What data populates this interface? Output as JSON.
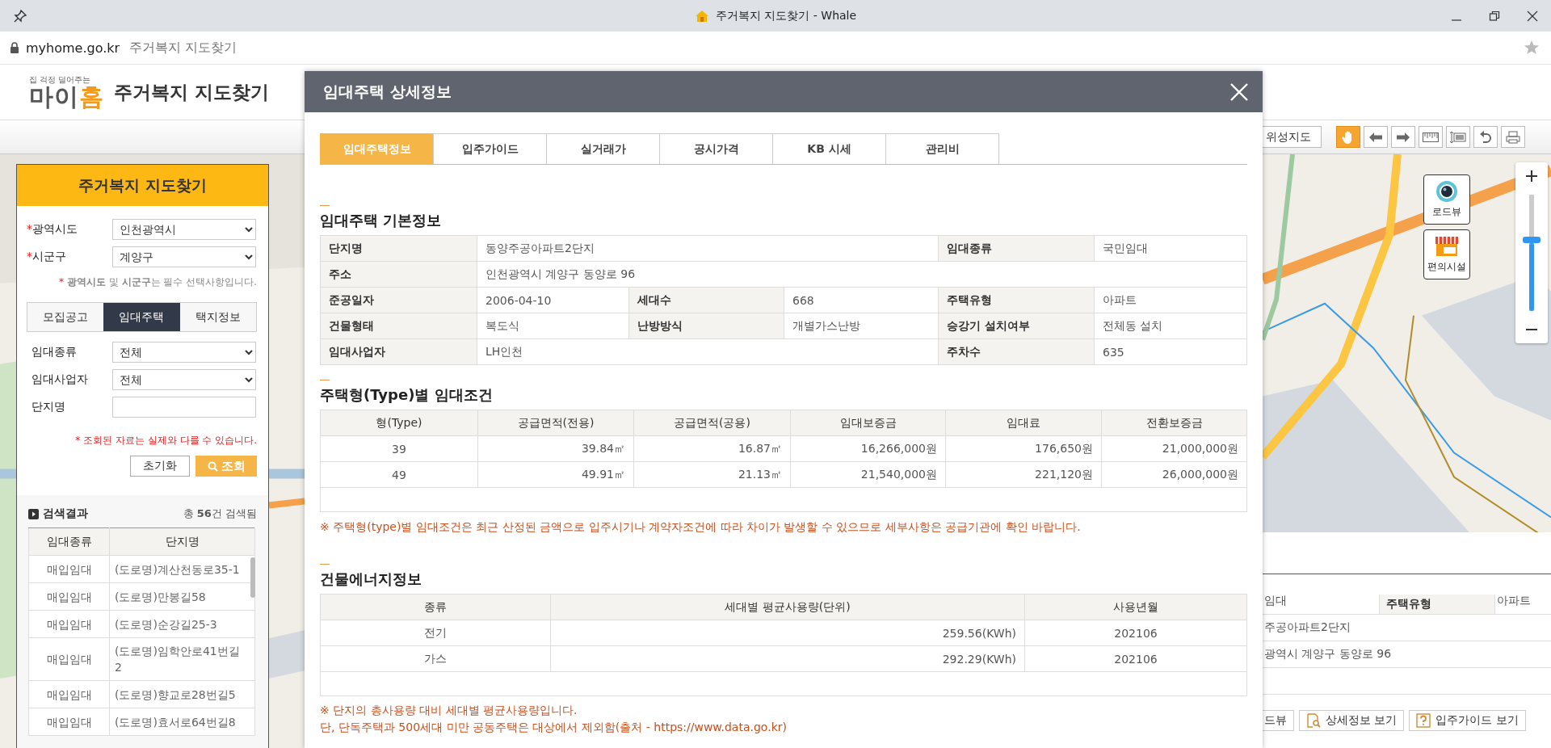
{
  "browser": {
    "title": "주거복지 지도찾기 - Whale",
    "url": "myhome.go.kr",
    "page_title": "주거복지 지도찾기"
  },
  "site_header": {
    "logo_tagline": "집 걱정 덜어주는",
    "logo_main": "마이",
    "logo_accent": "홈",
    "title": "주거복지 지도찾기"
  },
  "map_toolbar": {
    "satellite_button": "위성지도",
    "tools": [
      {
        "kind": "hand",
        "selected": true
      },
      {
        "kind": "prev",
        "selected": false
      },
      {
        "kind": "next",
        "selected": false
      },
      {
        "kind": "ruler",
        "selected": false
      },
      {
        "kind": "area",
        "selected": false
      },
      {
        "kind": "undo",
        "selected": false
      },
      {
        "kind": "print",
        "selected": false
      }
    ]
  },
  "map_overlay": {
    "buttons": [
      {
        "kind": "roadview",
        "label": "로드뷰"
      },
      {
        "kind": "facility",
        "label": "편의시설"
      }
    ],
    "zoom_slider": {
      "level": 0.62
    }
  },
  "search_panel": {
    "title": "주거복지 지도찾기",
    "fields": [
      {
        "mark": "*",
        "label": "광역시도",
        "kind": "select",
        "value": "인천광역시"
      },
      {
        "mark": "*",
        "label": "시군구",
        "kind": "select",
        "value": "계양구"
      }
    ],
    "note_mark": "*",
    "note": "**광역시도** 및 **시군구**는 필수 선택사항입니다.",
    "tabs": [
      {
        "label": "모집공고",
        "selected": false
      },
      {
        "label": "임대주택",
        "selected": true
      },
      {
        "label": "택지정보",
        "selected": false
      }
    ],
    "filters": [
      {
        "label": "임대종류",
        "kind": "select",
        "value": "전체"
      },
      {
        "label": "임대사업자",
        "kind": "select",
        "value": "전체"
      },
      {
        "label": "단지명",
        "kind": "input"
      }
    ],
    "disclaimer": "* 조회된 자료는 실제와 다를 수 있습니다.",
    "reset_button": "초기화",
    "search_button": "조회",
    "results": {
      "title": "검색결과",
      "total": "총 **56**건 검색됨",
      "columns": [
        "임대종류",
        "단지명"
      ],
      "rows": [
        [
          "매입임대",
          "(도로명)계산천동로35-1"
        ],
        [
          "매입임대",
          "(도로명)만봉길58"
        ],
        [
          "매입임대",
          "(도로명)순강길25-3"
        ],
        [
          "매입임대",
          "(도로명)임학안로41번길2"
        ],
        [
          "매입임대",
          "(도로명)향교로28번길5"
        ],
        [
          "매입임대",
          "(도로명)효서로64번길8"
        ]
      ]
    }
  },
  "modal": {
    "title": "임대주택 상세정보",
    "tabs": [
      {
        "label": "임대주택정보",
        "selected": true
      },
      {
        "label": "입주가이드",
        "selected": false
      },
      {
        "label": "실거래가",
        "selected": false
      },
      {
        "label": "공시가격",
        "selected": false
      },
      {
        "label": "KB 시세",
        "selected": false
      },
      {
        "label": "관리비",
        "selected": false
      }
    ],
    "basic_info": {
      "title": "임대주택 기본정보",
      "lines": [
        [
          {
            "label": "단지명",
            "value": "동양주공아파트2단지"
          },
          {
            "label": "임대종류",
            "value": "국민임대"
          }
        ],
        [
          {
            "label": "주소",
            "value": "인천광역시 계양구 동양로 96"
          }
        ],
        [
          {
            "label": "준공일자",
            "value": "2006-04-10"
          },
          {
            "label": "세대수",
            "value": "668"
          },
          {
            "label": "주택유형",
            "value": "아파트"
          }
        ],
        [
          {
            "label": "건물형태",
            "value": "복도식"
          },
          {
            "label": "난방방식",
            "value": "개별가스난방"
          },
          {
            "label": "승강기 설치여부",
            "value": "전체동 설치"
          }
        ],
        [
          {
            "label": "임대사업자",
            "value": "LH인천"
          },
          {
            "label": "주차수",
            "value": "635"
          }
        ]
      ]
    },
    "rent_conditions": {
      "title": "주택형(Type)별 임대조건",
      "columns": [
        "형(Type)",
        "공급면적(전용)",
        "공급면적(공용)",
        "임대보증금",
        "임대료",
        "전환보증금"
      ],
      "rows": [
        [
          "39",
          "39.84㎡",
          "16.87㎡",
          "16,266,000원",
          "176,650원",
          "21,000,000원"
        ],
        [
          "49",
          "49.91㎡",
          "21.13㎡",
          "21,540,000원",
          "221,120원",
          "26,000,000원"
        ]
      ]
    },
    "rent_note": "※ 주택형(type)별 임대조건은 최근 산정된 금액으로 입주시기나 계약자조건에 따라 차이가 발생할 수 있으므로 세부사항은 공급기관에 확인 바랍니다.",
    "energy": {
      "title": "건물에너지정보",
      "columns": [
        "종류",
        "세대별 평균사용량(단위)",
        "사용년월"
      ],
      "rows": [
        [
          "전기",
          "259.56(KWh)",
          "202106"
        ],
        [
          "가스",
          "292.29(KWh)",
          "202106"
        ]
      ]
    },
    "energy_notes": [
      "※ 단지의 총사용량 대비 세대별 평균사용량입니다.",
      "단, 단독주택과 500세대 미만 공동주택은 대상에서 제외함(출처 - https://www.data.go.kr)"
    ]
  },
  "info_panel": {
    "rows": [
      {
        "cells": [
          {
            "kind": "value",
            "text": "임대"
          },
          {
            "kind": "label",
            "text": "주택유형"
          },
          {
            "kind": "value",
            "text": "아파트"
          }
        ]
      },
      {
        "cells": [
          {
            "kind": "value",
            "text": "주공아파트2단지"
          }
        ]
      },
      {
        "cells": [
          {
            "kind": "value",
            "text": "광역시 계양구 동양로 96"
          }
        ]
      }
    ],
    "buttons": [
      {
        "kind": "plain",
        "label": "드뷰"
      },
      {
        "kind": "detail",
        "label": "상세정보 보기"
      },
      {
        "kind": "guide",
        "label": "입주가이드 보기"
      }
    ]
  }
}
